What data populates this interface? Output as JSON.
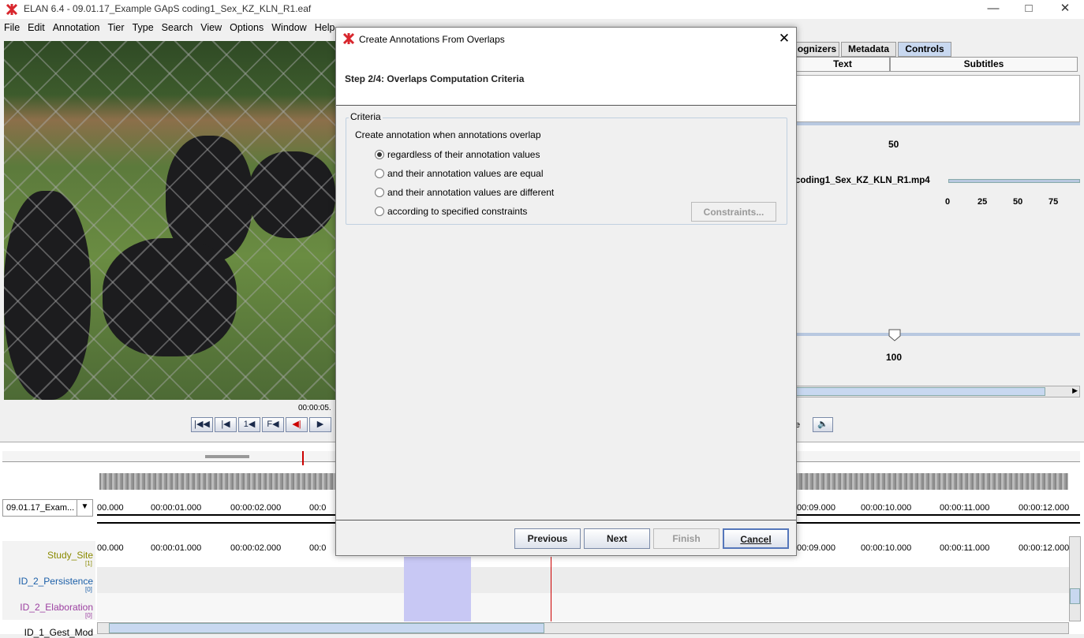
{
  "window": {
    "title": "ELAN 6.4 - 09.01.17_Example GApS coding1_Sex_KZ_KLN_R1.eaf",
    "min_icon": "minimize-icon",
    "max_icon": "maximize-icon",
    "close_icon": "close-icon"
  },
  "menu": [
    "File",
    "Edit",
    "Annotation",
    "Tier",
    "Type",
    "Search",
    "View",
    "Options",
    "Window",
    "Help"
  ],
  "menu_help_partial": "Help",
  "player": {
    "time": "00:00:05."
  },
  "right_tabs": {
    "tab1": "ognizers",
    "tab2": "Metadata",
    "tab3": "Controls",
    "subtab1": "Text",
    "subtab2": "Subtitles"
  },
  "right_panel": {
    "slider_top_label": "50",
    "media_name": "coding1_Sex_KZ_KLN_R1.mp4",
    "media_ticks": [
      "0",
      "25",
      "50",
      "75"
    ],
    "slider_bottom_label": "100",
    "volume_partial": "e"
  },
  "timeline": {
    "tier_selector": "09.01.17_Exam...",
    "ticks_left": [
      "00.000",
      "00:00:01.000",
      "00:00:02.000",
      "00:0"
    ],
    "ticks_right": [
      "00:09.000",
      "00:00:10.000",
      "00:00:11.000",
      "00:00:12.000"
    ],
    "tiers": [
      {
        "name": "Study_Site",
        "count": "[1]",
        "color": "#8a8a00"
      },
      {
        "name": "ID_2_Persistence",
        "count": "[0]",
        "color": "#1b5fa8"
      },
      {
        "name": "ID_2_Elaboration",
        "count": "[0]",
        "color": "#9b3fa0"
      },
      {
        "name": "ID_1_Gest_Mod",
        "count": "",
        "color": "#000000"
      }
    ]
  },
  "dialog": {
    "title": "Create Annotations From Overlaps",
    "step": "Step 2/4: Overlaps Computation Criteria",
    "group_label": "Criteria",
    "instruction": "Create annotation when annotations overlap",
    "options": [
      {
        "label": "regardless of their annotation values",
        "selected": true
      },
      {
        "label": "and their annotation values are equal",
        "selected": false
      },
      {
        "label": "and their annotation values are different",
        "selected": false
      },
      {
        "label": "according to specified constraints",
        "selected": false
      }
    ],
    "constraints_button": "Constraints...",
    "buttons": {
      "previous": "Previous",
      "next": "Next",
      "finish": "Finish",
      "cancel": "Cancel"
    }
  },
  "colors": {
    "accent": "#c8d8f0",
    "selection": "#c8c8f4",
    "cursor": "#cc0000"
  }
}
